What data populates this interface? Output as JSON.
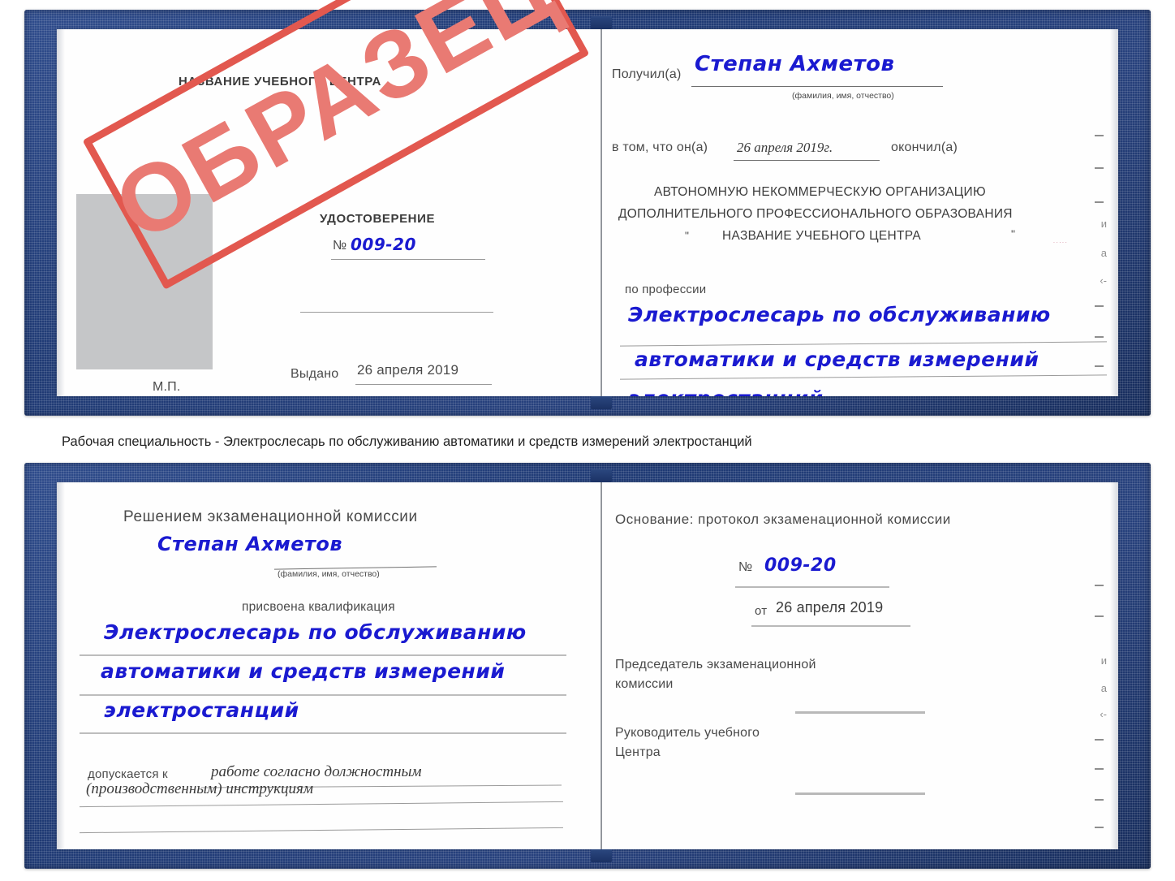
{
  "colors": {
    "cover_navy": "#1f3a74",
    "stamp_red": "#e2584f",
    "stamp_text_red": "#e97a73",
    "handwriting_blue": "#1a1ad0",
    "photo_placeholder_gray": "#c5c6c8"
  },
  "watermark": {
    "text": "ОБРАЗЕЦ"
  },
  "certificate_top": {
    "left_page": {
      "center_title": "НАЗВАНИЕ УЧЕБНОГО ЦЕНТРА",
      "doc_type": "УДОСТОВЕРЕНИЕ",
      "number_label": "№",
      "number_value": "009-20",
      "issued_label": "Выдано",
      "issued_value": "26 апреля 2019",
      "seal_label": "М.П.",
      "photo_placeholder": "photo-placeholder"
    },
    "right_page": {
      "received_label": "Получил(а)",
      "received_value": "Степан Ахметов",
      "fio_hint": "(фамилия, имя, отчество)",
      "in_that_label": "в том, что он(а)",
      "completion_date": "26 апреля 2019г.",
      "finished_label": "окончил(а)",
      "org_line1": "АВТОНОМНУЮ НЕКОММЕРЧЕСКУЮ ОРГАНИЗАЦИЮ",
      "org_line2": "ДОПОЛНИТЕЛЬНОГО ПРОФЕССИОНАЛЬНОГО ОБРАЗОВАНИЯ",
      "org_quote_open": "\"",
      "org_line3": "НАЗВАНИЕ УЧЕБНОГО ЦЕНТРА",
      "org_quote_close": "\"",
      "profession_label": "по профессии",
      "profession_line1": "Электрослесарь по обслуживанию",
      "profession_line2": "автоматики и средств измерений",
      "profession_line3": "электростанций",
      "ghost_marks": [
        "и",
        "а",
        "‹-"
      ]
    }
  },
  "caption": {
    "text": "Рабочая специальность - Электрослесарь по обслуживанию автоматики и средств измерений электростанций"
  },
  "certificate_bottom": {
    "left_page": {
      "heading": "Решением экзаменационной комиссии",
      "name_value": "Степан Ахметов",
      "fio_hint": "(фамилия, имя, отчество)",
      "qualification_label": "присвоена квалификация",
      "qualification_line1": "Электрослесарь по обслуживанию",
      "qualification_line2": "автоматики и средств измерений",
      "qualification_line3": "электростанций",
      "allowed_label": "допускается к",
      "allowed_line1": "работе согласно должностным",
      "allowed_line2": "(производственным) инструкциям"
    },
    "right_page": {
      "basis_label": "Основание: протокол экзаменационной комиссии",
      "number_label": "№",
      "number_value": "009-20",
      "date_label": "от",
      "date_value": "26 апреля 2019",
      "chairman_line1": "Председатель экзаменационной",
      "chairman_line2": "комиссии",
      "director_line1": "Руководитель учебного",
      "director_line2": "Центра",
      "ghost_marks": [
        "и",
        "а",
        "‹-"
      ]
    }
  }
}
